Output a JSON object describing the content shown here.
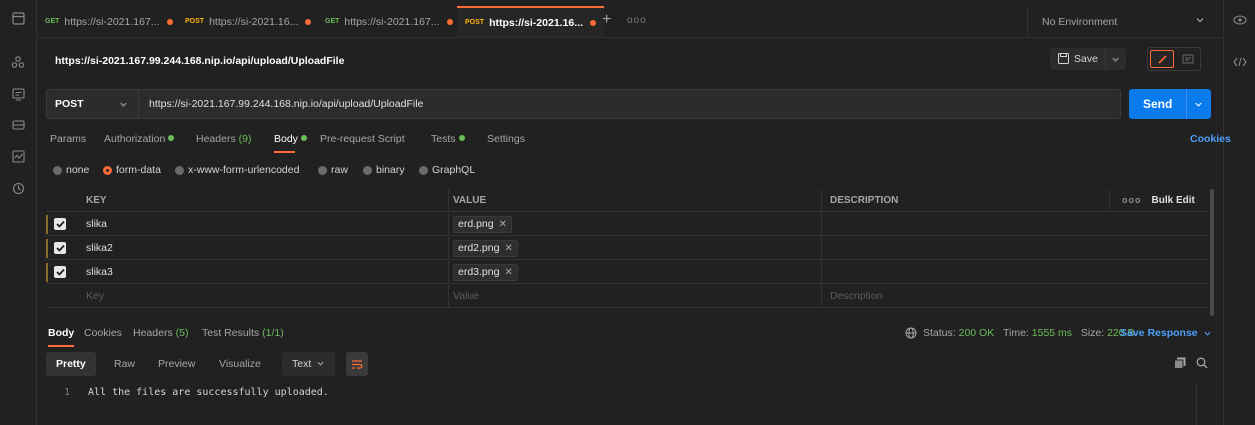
{
  "tabs": [
    {
      "method": "GET",
      "label": "https://si-2021.167...",
      "active": false
    },
    {
      "method": "POST",
      "label": "https://si-2021.16...",
      "active": false
    },
    {
      "method": "GET",
      "label": "https://si-2021.167...",
      "active": false
    },
    {
      "method": "POST",
      "label": "https://si-2021.16...",
      "active": true
    }
  ],
  "tab_add": "+",
  "tab_more": "ooo",
  "environment": {
    "label": "No Environment"
  },
  "request": {
    "title": "https://si-2021.167.99.244.168.nip.io/api/upload/UploadFile",
    "method": "POST",
    "url": "https://si-2021.167.99.244.168.nip.io/api/upload/UploadFile",
    "save_label": "Save",
    "send_label": "Send"
  },
  "request_tabs": {
    "params": "Params",
    "authorization": "Authorization",
    "headers": "Headers",
    "headers_count": "(9)",
    "body": "Body",
    "pre_request": "Pre-request Script",
    "tests": "Tests",
    "settings": "Settings",
    "cookies": "Cookies"
  },
  "body_types": [
    {
      "label": "none",
      "selected": false
    },
    {
      "label": "form-data",
      "selected": true
    },
    {
      "label": "x-www-form-urlencoded",
      "selected": false
    },
    {
      "label": "raw",
      "selected": false
    },
    {
      "label": "binary",
      "selected": false
    },
    {
      "label": "GraphQL",
      "selected": false
    }
  ],
  "form_table": {
    "headers": {
      "key": "KEY",
      "value": "VALUE",
      "description": "DESCRIPTION",
      "bulk_edit": "Bulk Edit",
      "more": "ooo"
    },
    "rows": [
      {
        "checked": true,
        "key": "slika",
        "value": "erd.png",
        "description": ""
      },
      {
        "checked": true,
        "key": "slika2",
        "value": "erd2.png",
        "description": ""
      },
      {
        "checked": true,
        "key": "slika3",
        "value": "erd3.png",
        "description": ""
      }
    ],
    "placeholders": {
      "key": "Key",
      "value": "Value",
      "description": "Description"
    }
  },
  "response_tabs": {
    "body": "Body",
    "cookies": "Cookies",
    "headers": "Headers",
    "headers_count": "(5)",
    "test_results": "Test Results",
    "test_results_count": "(1/1)"
  },
  "response_status": {
    "status_label": "Status:",
    "status_value": "200 OK",
    "time_label": "Time:",
    "time_value": "1555 ms",
    "size_label": "Size:",
    "size_value": "220 B",
    "save_response": "Save Response"
  },
  "format_bar": {
    "pretty": "Pretty",
    "raw": "Raw",
    "preview": "Preview",
    "visualize": "Visualize",
    "type_selected": "Text"
  },
  "response_body": {
    "line_number": "1",
    "text": "All the files are successfully uploaded."
  },
  "colors": {
    "accent": "#ff6c37",
    "send": "#097bed",
    "success": "#6bbd5b",
    "link": "#4d9ff7"
  },
  "icons": {
    "left_rail": [
      "new-tab-icon",
      "team-icon",
      "api-icon",
      "environment-icon",
      "monitor-icon",
      "history-icon"
    ],
    "right_rail": [
      "eye-icon",
      "code-icon"
    ]
  }
}
